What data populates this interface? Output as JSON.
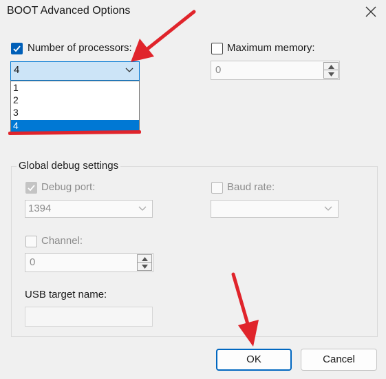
{
  "window": {
    "title": "BOOT Advanced Options"
  },
  "processors": {
    "label": "Number of processors:",
    "checked": true,
    "selected": "4",
    "options": [
      "1",
      "2",
      "3",
      "4"
    ]
  },
  "memory": {
    "label": "Maximum memory:",
    "checked": false,
    "value": "0"
  },
  "debug": {
    "group_title": "Global debug settings",
    "debug_port_label": "Debug port:",
    "debug_port_value": "1394",
    "baud_rate_label": "Baud rate:",
    "baud_rate_value": "",
    "channel_label": "Channel:",
    "channel_value": "0",
    "usb_label": "USB target name:",
    "usb_value": ""
  },
  "buttons": {
    "ok": "OK",
    "cancel": "Cancel"
  },
  "colors": {
    "accent": "#0078d4",
    "annotation_red": "#e0242b"
  }
}
